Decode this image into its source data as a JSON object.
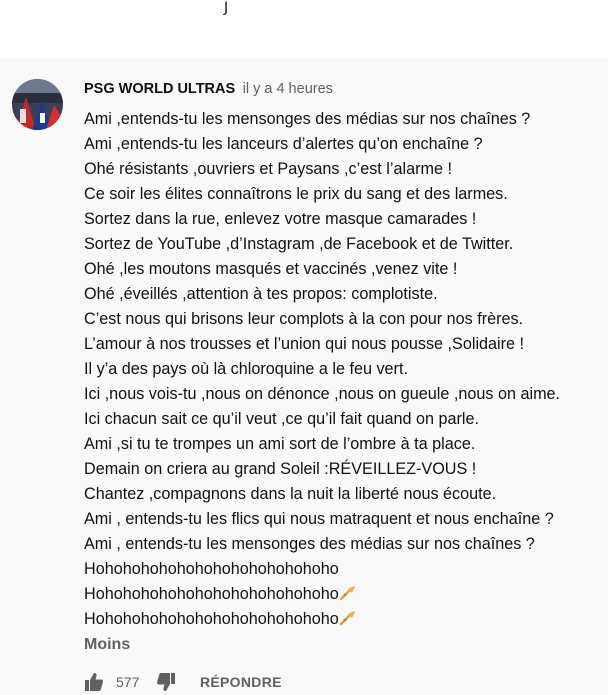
{
  "top_mark": "J",
  "comment": {
    "author": "PSG WORLD ULTRAS",
    "time": "il y a 4 heures",
    "lines": [
      "Ami ,entends-tu les mensonges des médias sur nos chaînes ?",
      "Ami ,entends-tu les lanceurs d’alertes qu’on enchaîne ?",
      "Ohé résistants ,ouvriers et Paysans ,c’est l’alarme !",
      "Ce soir les élites connaîtrons le prix du sang et des larmes.",
      "Sortez dans la rue, enlevez votre masque camarades !",
      "Sortez de YouTube ,d’Instagram ,de Facebook et de Twitter.",
      "Ohé ,les moutons masqués et vaccinés ,venez vite !",
      "Ohé ,éveillés ,attention à tes propos: complotiste.",
      "C’est nous qui brisons leur complots à la con pour nos frères.",
      "L’amour à nos trousses et l’union qui nous pousse ,Solidaire !",
      "Il y’a des pays où là chloroquine a le feu vert.",
      "Ici ,nous vois-tu ,nous on dénonce ,nous on gueule ,nous on aime.",
      "Ici chacun sait ce qu’il veut ,ce qu’il fait quand on parle.",
      "Ami ,si tu te trompes un ami sort de l’ombre à ta place.",
      "Demain on criera au grand Soleil :RÉVEILLEZ-VOUS !",
      "Chantez ,compagnons dans la nuit la liberté nous écoute.",
      "Ami , entends-tu les flics qui nous matraquent et nous enchaîne ?",
      "Ami , entends-tu les mensonges des médias sur nos chaînes ?",
      "Hohohohohohohohohohohohohoho",
      "Hohohohohohohohohohohohohoho",
      "Hohohohohohohohohohohohohoho"
    ],
    "emoji_lines": [
      19,
      20
    ],
    "less_label": "Moins",
    "like_count": "577",
    "reply_label": "RÉPONDRE"
  },
  "icons": {
    "avatar": "avatar-image",
    "emoji": "trumpet-emoji-icon",
    "like": "thumb-up-icon",
    "dislike": "thumb-down-icon"
  },
  "colors": {
    "text": "#111111",
    "secondary": "#606060",
    "background": "#f9f9f9"
  }
}
